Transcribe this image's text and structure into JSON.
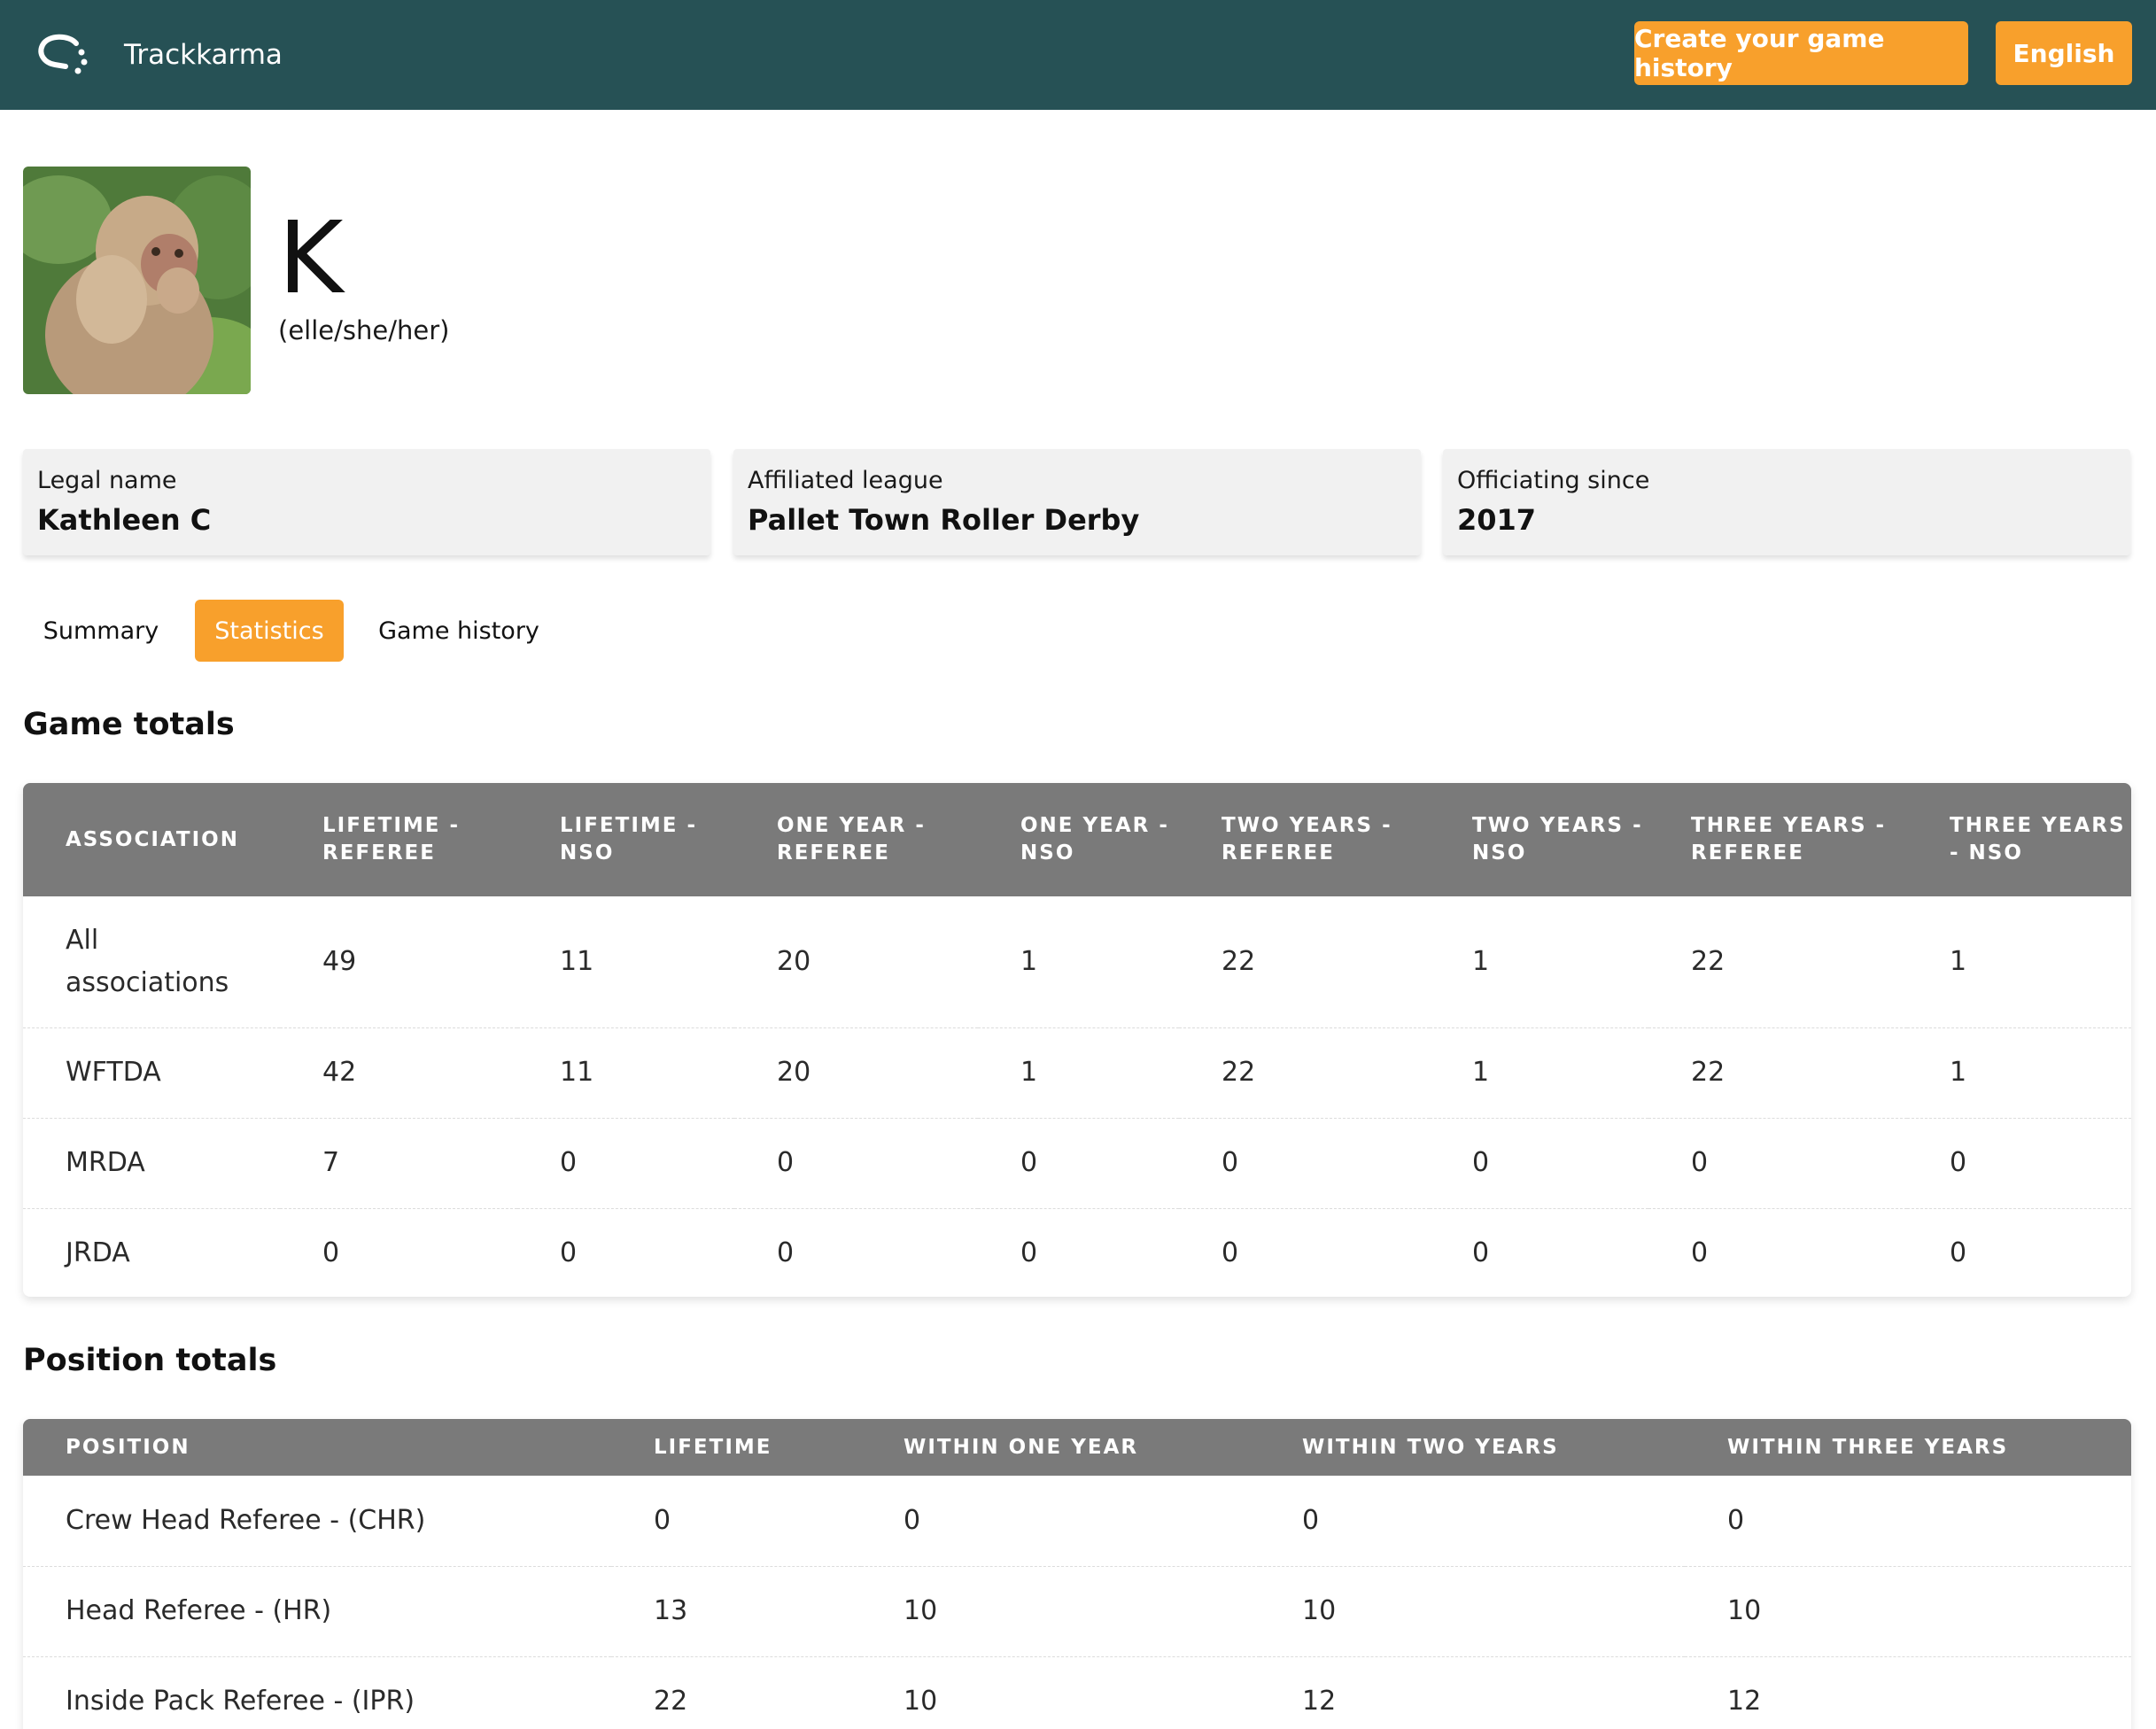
{
  "header": {
    "brand_name": "Trackkarma",
    "create_button_label": "Create your game history",
    "language_button_label": "English"
  },
  "profile": {
    "display_name": "K",
    "pronouns": "(elle/she/her)"
  },
  "info_cards": [
    {
      "label": "Legal name",
      "value": "Kathleen C"
    },
    {
      "label": "Affiliated league",
      "value": "Pallet Town Roller Derby"
    },
    {
      "label": "Officiating since",
      "value": "2017"
    }
  ],
  "tabs": [
    {
      "label": "Summary",
      "active": false
    },
    {
      "label": "Statistics",
      "active": true
    },
    {
      "label": "Game history",
      "active": false
    }
  ],
  "game_totals": {
    "title": "Game totals",
    "headers": [
      "Association",
      "Lifetime - Referee",
      "Lifetime - NSO",
      "One year - Referee",
      "One year - NSO",
      "Two years - Referee",
      "Two years - NSO",
      "Three years - Referee",
      "Three years - NSO"
    ],
    "rows": [
      [
        "All associations",
        "49",
        "11",
        "20",
        "1",
        "22",
        "1",
        "22",
        "1"
      ],
      [
        "WFTDA",
        "42",
        "11",
        "20",
        "1",
        "22",
        "1",
        "22",
        "1"
      ],
      [
        "MRDA",
        "7",
        "0",
        "0",
        "0",
        "0",
        "0",
        "0",
        "0"
      ],
      [
        "JRDA",
        "0",
        "0",
        "0",
        "0",
        "0",
        "0",
        "0",
        "0"
      ]
    ]
  },
  "position_totals": {
    "title": "Position totals",
    "headers": [
      "Position",
      "Lifetime",
      "Within one year",
      "Within two years",
      "Within three years"
    ],
    "rows": [
      [
        "Crew Head Referee - (CHR)",
        "0",
        "0",
        "0",
        "0"
      ],
      [
        "Head Referee - (HR)",
        "13",
        "10",
        "10",
        "10"
      ],
      [
        "Inside Pack Referee - (IPR)",
        "22",
        "10",
        "12",
        "12"
      ]
    ]
  },
  "colors": {
    "topbar": "#265155",
    "accent": "#f8a02c",
    "table_header": "#7a7a7a",
    "card_bg": "#f1f1f1"
  },
  "icons": {
    "brand_logo": "trackkarma-logo-icon",
    "avatar": "profile-photo-monkey"
  }
}
